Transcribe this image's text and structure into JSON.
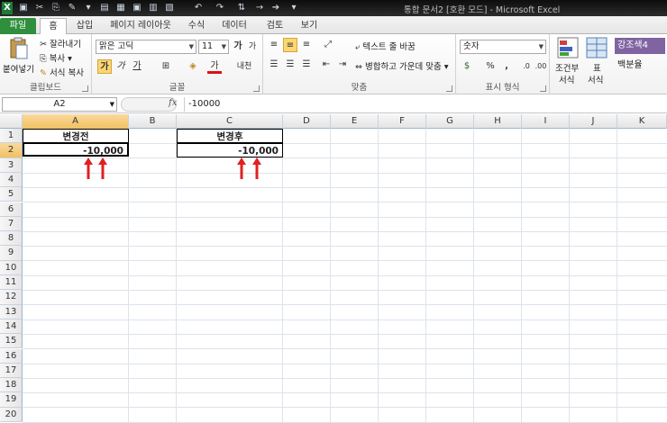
{
  "window": {
    "title": "통합 문서2 [호환 모드] - Microsoft Excel"
  },
  "quick_access": [
    {
      "icon": "excel-logo-icon"
    },
    {
      "icon": "undo-icon"
    },
    {
      "icon": "redo-icon"
    }
  ],
  "tabs": [
    "파일",
    "홈",
    "삽입",
    "페이지 레이아웃",
    "수식",
    "데이터",
    "검토",
    "보기"
  ],
  "clipboard": {
    "paste_label": "붙여넣기",
    "cut_label": "잘라내기",
    "copy_label": "복사",
    "format_painter_label": "서식 복사",
    "group_label": "클립보드"
  },
  "font": {
    "font_name": "맑은 고딕",
    "font_size": "11",
    "bold_label": "가",
    "italic_label": "가",
    "underline_label": "가",
    "font_color_label": "가",
    "phonetic_label": "내천",
    "grow_label": "가",
    "shrink_label": "가",
    "group_label": "글꼴"
  },
  "alignment": {
    "wrap_text_label": "텍스트 줄 바꿈",
    "merge_label": "병합하고 가운데 맞춤",
    "group_label": "맞춤"
  },
  "number": {
    "format": "숫자",
    "percent": "%",
    "comma": ",",
    "group_label": "표시 형식"
  },
  "styles": {
    "conditional_label_1": "조건부",
    "conditional_label_2": "서식",
    "table_label_1": "표",
    "table_label_2": "서식",
    "style_1": "강조색4",
    "style_2": "백분율"
  },
  "formula_bar": {
    "name_box": "A2",
    "formula": "-10000"
  },
  "columns": [
    "A",
    "B",
    "C",
    "D",
    "E",
    "F",
    "G",
    "H",
    "I",
    "J",
    "K"
  ],
  "rows": [
    "1",
    "2",
    "3",
    "4",
    "5",
    "6",
    "7",
    "8",
    "9",
    "10",
    "11",
    "12",
    "13",
    "14",
    "15",
    "16",
    "17",
    "18",
    "19",
    "20"
  ],
  "cells": {
    "A1": "변경전",
    "A2": "-10,000",
    "C1": "변경후",
    "C2": "-10,000"
  },
  "colors": {
    "file_tab": "#2f8f3c",
    "selected_header": "#f1c15f",
    "arrow": "#e02020",
    "style_swatch": "#8064a2"
  }
}
